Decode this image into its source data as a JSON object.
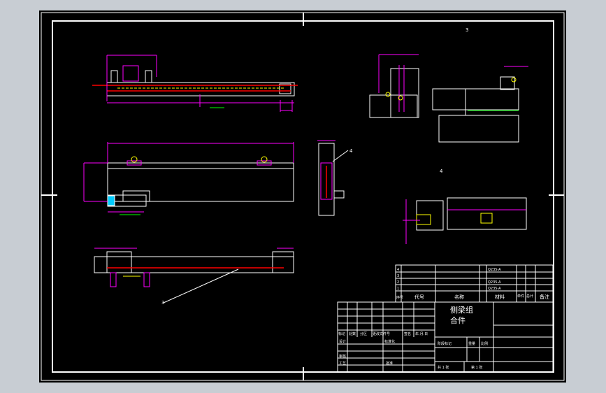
{
  "drawing": {
    "title_line1": "侧梁组",
    "title_line2": "合件",
    "view_labels": [
      "3",
      "4"
    ],
    "balloons": [
      "3",
      "4"
    ],
    "section_note": "",
    "weld_note": ""
  },
  "bom": {
    "headers": [
      "序号",
      "代号",
      "名称",
      "材料",
      "单件",
      "总计",
      "备注"
    ],
    "rows": [
      {
        "no": "4",
        "name": "",
        "material": "Q235-A"
      },
      {
        "no": "3",
        "name": "",
        "material": ""
      },
      {
        "no": "2",
        "name": "",
        "material": "Q235-A"
      },
      {
        "no": "1",
        "name": "",
        "material": "Q235-A"
      }
    ]
  },
  "title_block": {
    "revision_headers": [
      "标记",
      "处数",
      "分区",
      "更改文件号",
      "签名",
      "年.月.日"
    ],
    "design": "设计",
    "standardize": "标准化",
    "review": "审核",
    "process": "工艺",
    "approve": "批准",
    "stage_label": "阶段标记",
    "weight_label": "重量",
    "scale_label": "比例",
    "sheets_total": "共 1 张",
    "sheet_no": "第 1 张"
  },
  "colors": {
    "background": "#000000",
    "frame": "#ffffff",
    "dimension": "#ff00ff",
    "dim_text": "#00ff00",
    "centerline": "#ff0000",
    "part_outline": "#ffffff",
    "hidden": "#ffff00"
  }
}
